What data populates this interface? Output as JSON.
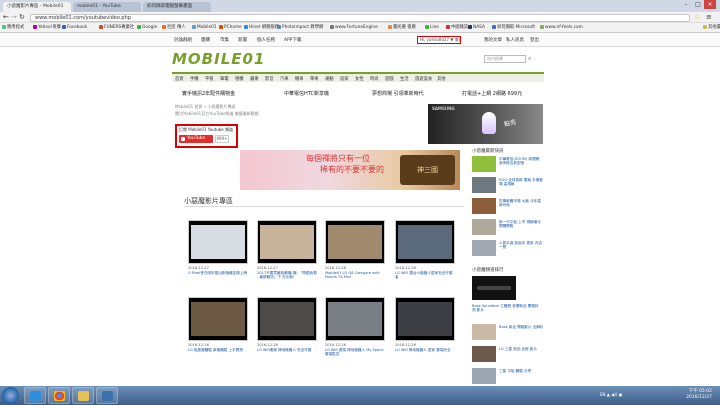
{
  "browser": {
    "tabs": [
      {
        "label": "小惡魔影片專區 - Mobile01",
        "active": true
      },
      {
        "label": "mobile01 - YouTube",
        "active": false
      },
      {
        "label": "如何擷取電腦螢幕畫面",
        "active": false
      }
    ],
    "url": "www.mobile01.com/youtubevideo.php",
    "bookmarks": [
      "應用程式",
      "Yahoo!奇摩",
      "Facebook",
      "FUNERS專業社",
      "Google",
      "社區 傳人",
      "Mobile01",
      "PChome",
      "Hinet 網路服務",
      "Photoimpact 教學網",
      "www.FortuneEngine",
      "農民曆 夜曆",
      "Line",
      "中國雜誌",
      "NASA",
      "如何擷取 Microsoft",
      "www.nf-feels.com",
      "其他書籤"
    ]
  },
  "topnav": {
    "left": [
      "討論群組",
      "團購",
      "市集",
      "新聞",
      "個人任務",
      "APP下載"
    ],
    "user": "Hi, yahoo8027 ▼ 會員中心",
    "right": [
      "我的文章",
      "私人訊息",
      "登出"
    ]
  },
  "site": {
    "logo": "MOBILE01",
    "search_placeholder": "站內搜尋",
    "categories": [
      "首頁",
      "手機",
      "平板",
      "筆電",
      "相機",
      "蘋果",
      "影音",
      "汽車",
      "機車",
      "單車",
      "運動",
      "居家",
      "女性",
      "時尚",
      "遊戲",
      "生活",
      "旅遊美食",
      "其他"
    ],
    "promos": [
      "實手機訊2年配件購物金",
      "中華電信HTC新享機",
      "夢想商場 引領革新時代",
      "打電話+上網 2網路 699元"
    ]
  },
  "page": {
    "breadcrumb": "Mobile01 首頁 » 小惡魔影片專區",
    "breadcrumb_sub": "關注Mobile01官方YouTube頻道 掌握最新動態",
    "subscribe_title": "訂閱 Mobile01 Youtube 頻道",
    "youtube_label": "YouTube",
    "subscriber_count": "999+",
    "section_title": "小惡魔影片專區",
    "ad_brand": "SAMSUNG",
    "ad_text": "點亮",
    "banner_line1": "每個禪將只有一位",
    "banner_line2": "稀有的不要不要的",
    "banner_game": "神三國"
  },
  "videos": [
    {
      "date": "2016-12-27",
      "title": "G Pixel會在明年推出新機種並傳上牌",
      "thumb": "#d8dde4"
    },
    {
      "date": "2016-12-27",
      "title": "2017不要買最新轉機(機) 「再跟我看 - 最新戰況」下 先比較!",
      "thumb": "#c7b39a"
    },
    {
      "date": "2016-12-26",
      "title": "Mobile01 LG Q6 Compare with Polaris TX-Mini",
      "thumb": "#a08b6e"
    },
    {
      "date": "2016-12-26",
      "title": "LG WiFi 雲台小機器人居家安全守護者",
      "thumb": "#5a6a7a"
    },
    {
      "date": "2016-12-26",
      "title": "LG 吸塵器體驗 新機體驗 上手實測",
      "thumb": "#6d5a45"
    },
    {
      "date": "2016-12-26",
      "title": "LG Wifi連線 掃地機器人 安全守護",
      "thumb": "#4e4a48"
    },
    {
      "date": "2016-12-26",
      "title": "LG Wifi 遠端 掃地機器人 My Space 雲端監控",
      "thumb": "#7a7f86"
    },
    {
      "date": "2016-12-26",
      "title": "LG Wifi 掃地機器人 居家 雲端安全",
      "thumb": "#3d3f45"
    }
  ],
  "sidebar": {
    "heading1": "小惡魔最新快訊",
    "news": [
      {
        "title": "中華電信(ZOOM) 新聞稿 宣佈推出新型號",
        "color": "#8fbf3a"
      },
      {
        "title": "ROG 全球首款 電競 手機登場 高規格",
        "color": "#6e7880"
      },
      {
        "title": "防毒軟體市場 大廠 今年重新布局",
        "color": "#8d5e3b"
      },
      {
        "title": "新一代平板 上市 規格曝光 預購開跑",
        "color": "#b0a99c"
      },
      {
        "title": "人氣手遊 新版本 更新 內容一覽",
        "color": "#a0a8b2"
      }
    ],
    "heading2": "小惡魔頻道排行",
    "rank_caption": "Bose Soundbar 立體聲 音響新品 開箱評測 影片",
    "rank_items": [
      {
        "title": "Bose 新品 開箱影片 全解析",
        "color": "#c9b9a5"
      },
      {
        "title": "LG 三星 新品 比較 影片",
        "color": "#6e5a4d"
      },
      {
        "title": "三星 平板 體驗 分享",
        "color": "#9aa6b3"
      }
    ]
  },
  "taskbar": {
    "time": "下午 05:02",
    "date": "2016/12/27",
    "tray": "EN ▲ ◀)) ▣"
  }
}
